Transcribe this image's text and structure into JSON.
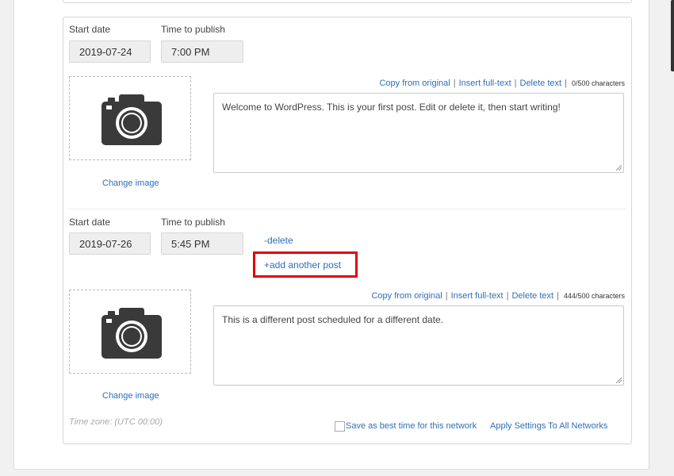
{
  "posts": [
    {
      "start_date_label": "Start date",
      "time_label": "Time to publish",
      "start_date": "2019-07-24",
      "time": "7:00 PM",
      "change_image": "Change image",
      "toolbar": {
        "copy": "Copy from original",
        "insert": "Insert full-text",
        "delete_text": "Delete text",
        "count": "0/500 characters"
      },
      "text": "Welcome to WordPress. This is your first post. Edit or delete it, then start writing!"
    },
    {
      "start_date_label": "Start date",
      "time_label": "Time to publish",
      "start_date": "2019-07-26",
      "time": "5:45 PM",
      "delete_link": "-delete",
      "add_link": "+add another post",
      "change_image": "Change image",
      "toolbar": {
        "copy": "Copy from original",
        "insert": "Insert full-text",
        "delete_text": "Delete text",
        "count": "444/500 characters"
      },
      "text": "This is a different post scheduled for a different date."
    }
  ],
  "footer": {
    "timezone": "Time zone: (UTC 00:00)",
    "best_time": "Save as best time for this network",
    "apply_all": "Apply Settings To All Networks"
  },
  "icons": {
    "image_placeholder": "camera-icon",
    "resize": "resize-grip-icon"
  },
  "colors": {
    "link": "#2f6fb7",
    "highlight": "#e50000"
  }
}
